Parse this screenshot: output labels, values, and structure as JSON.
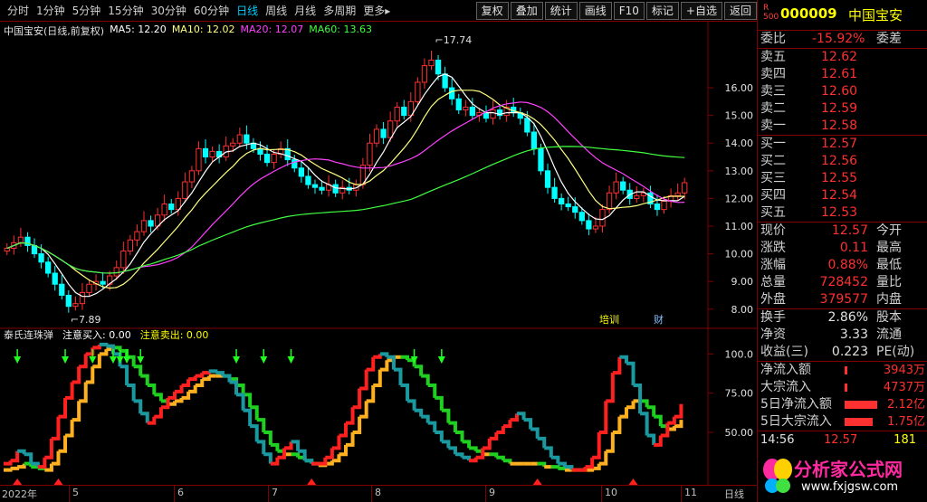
{
  "toolbar": {
    "periods": [
      {
        "label": "分时",
        "active": false
      },
      {
        "label": "1分钟",
        "active": false
      },
      {
        "label": "5分钟",
        "active": false
      },
      {
        "label": "15分钟",
        "active": false
      },
      {
        "label": "30分钟",
        "active": false
      },
      {
        "label": "60分钟",
        "active": false
      },
      {
        "label": "日线",
        "active": true
      },
      {
        "label": "周线",
        "active": false
      },
      {
        "label": "月线",
        "active": false
      },
      {
        "label": "多周期",
        "active": false
      },
      {
        "label": "更多▸",
        "active": false
      }
    ],
    "tools": [
      "复权",
      "叠加",
      "统计",
      "画线",
      "F10",
      "标记",
      "+自选",
      "返回"
    ]
  },
  "main_title": {
    "stock": "中国宝安(日线,前复权)",
    "ma": [
      {
        "label": "MA5: 12.20",
        "color": "#ffffff"
      },
      {
        "label": "MA10: 12.02",
        "color": "#ffff80"
      },
      {
        "label": "MA20: 12.07",
        "color": "#ff40ff"
      },
      {
        "label": "MA60: 13.63",
        "color": "#40ff40"
      }
    ]
  },
  "sub_title": {
    "name": "泰氏连珠弹",
    "buy": "注意买入: 0.00",
    "sell": "注意卖出: 0.00"
  },
  "chart_data": [
    {
      "type": "candlestick",
      "title": "中国宝安(日线,前复权)",
      "ylim": [
        7.6,
        17.8
      ],
      "y_ticks": [
        "16.00",
        "15.00",
        "14.00",
        "13.00",
        "12.00",
        "11.00",
        "10.00",
        "9.00",
        "8.00"
      ],
      "annotations": [
        "17.74",
        "7.89"
      ],
      "markers": [
        "培训",
        "财"
      ],
      "closes": [
        10.2,
        10.4,
        10.6,
        10.3,
        10.0,
        9.7,
        9.3,
        8.9,
        8.5,
        8.1,
        8.2,
        8.6,
        8.9,
        9.0,
        8.9,
        9.2,
        9.5,
        10.1,
        10.5,
        10.8,
        11.2,
        11.0,
        11.4,
        11.8,
        11.6,
        12.0,
        12.6,
        13.0,
        13.8,
        13.5,
        13.7,
        13.5,
        13.9,
        14.0,
        14.3,
        14.0,
        13.8,
        13.6,
        13.3,
        13.6,
        13.8,
        13.4,
        13.1,
        12.8,
        12.5,
        12.4,
        12.3,
        12.5,
        12.2,
        12.4,
        12.3,
        12.5,
        13.2,
        14.0,
        14.5,
        14.2,
        14.8,
        15.3,
        15.0,
        15.5,
        16.2,
        16.8,
        17.0,
        16.5,
        16.0,
        15.6,
        15.2,
        15.3,
        15.0,
        15.1,
        14.9,
        15.2,
        15.0,
        15.3,
        15.1,
        14.9,
        14.4,
        13.8,
        13.0,
        12.4,
        12.0,
        11.8,
        11.7,
        11.5,
        11.2,
        10.9,
        11.0,
        11.6,
        12.2,
        12.6,
        12.3,
        12.0,
        12.1,
        12.2,
        11.8,
        11.6,
        11.9,
        12.1,
        12.2,
        12.57
      ],
      "ma_series": [
        {
          "name": "MA5",
          "color": "#ffffff"
        },
        {
          "name": "MA10",
          "color": "#ffff80"
        },
        {
          "name": "MA20",
          "color": "#ff40ff"
        },
        {
          "name": "MA60",
          "color": "#40ff40"
        }
      ]
    },
    {
      "type": "line",
      "title": "泰氏连珠弹",
      "ylim": [
        20,
        110
      ],
      "y_ticks": [
        "100.0",
        "75.00",
        "50.00"
      ],
      "values_a": [
        30,
        32,
        38,
        36,
        30,
        28,
        34,
        46,
        60,
        72,
        82,
        92,
        100,
        104,
        106,
        105,
        100,
        92,
        80,
        70,
        62,
        56,
        60,
        66,
        72,
        76,
        80,
        84,
        86,
        88,
        89,
        88,
        86,
        82,
        74,
        64,
        54,
        44,
        36,
        30,
        34,
        40,
        44,
        38,
        32,
        30,
        30,
        34,
        40,
        48,
        56,
        66,
        78,
        90,
        98,
        100,
        98,
        90,
        80,
        70,
        64,
        60,
        56,
        50,
        44,
        40,
        36,
        34,
        32,
        34,
        40,
        46,
        50,
        54,
        58,
        62,
        58,
        52,
        46,
        40,
        34,
        30,
        28,
        26,
        26,
        28,
        34,
        50,
        70,
        88,
        98,
        94,
        80,
        62,
        48,
        42,
        48,
        56,
        60,
        68
      ],
      "values_b": [
        26,
        27,
        28,
        30,
        28,
        27,
        26,
        30,
        38,
        48,
        58,
        70,
        82,
        92,
        100,
        103,
        104,
        102,
        98,
        92,
        86,
        80,
        74,
        70,
        68,
        70,
        72,
        76,
        80,
        84,
        86,
        86,
        86,
        84,
        80,
        74,
        66,
        58,
        50,
        42,
        38,
        36,
        36,
        34,
        32,
        30,
        29,
        30,
        32,
        36,
        42,
        50,
        60,
        70,
        80,
        90,
        96,
        98,
        98,
        96,
        92,
        86,
        80,
        72,
        64,
        56,
        50,
        44,
        40,
        38,
        36,
        36,
        34,
        32,
        30,
        30,
        30,
        30,
        30,
        28,
        28,
        27,
        26,
        26,
        26,
        26,
        27,
        30,
        38,
        50,
        60,
        66,
        70,
        70,
        66,
        60,
        54,
        52,
        54,
        58
      ],
      "buy_markers": [
        2,
        9,
        13,
        16,
        17,
        18,
        20,
        34,
        38,
        42,
        60,
        64
      ]
    }
  ],
  "date_axis": [
    "2022年",
    "5",
    "6",
    "7",
    "8",
    "9",
    "10",
    "11",
    "日线"
  ],
  "panel": {
    "code": "000009",
    "name": "中国宝安",
    "flag_top": "R",
    "flag_bottom": "500",
    "weibi": {
      "label": "委比",
      "value": "-15.92%",
      "extra": "委差"
    },
    "sell": [
      {
        "label": "卖五",
        "price": "12.62"
      },
      {
        "label": "卖四",
        "price": "12.61"
      },
      {
        "label": "卖三",
        "price": "12.60"
      },
      {
        "label": "卖二",
        "price": "12.59"
      },
      {
        "label": "卖一",
        "price": "12.58"
      }
    ],
    "buy": [
      {
        "label": "买一",
        "price": "12.57"
      },
      {
        "label": "买二",
        "price": "12.56"
      },
      {
        "label": "买三",
        "price": "12.55"
      },
      {
        "label": "买四",
        "price": "12.54"
      },
      {
        "label": "买五",
        "price": "12.53"
      }
    ],
    "quote": [
      {
        "label": "现价",
        "value": "12.57",
        "extra": "今开"
      },
      {
        "label": "涨跌",
        "value": "0.11",
        "extra": "最高"
      },
      {
        "label": "涨幅",
        "value": "0.88%",
        "extra": "最低"
      },
      {
        "label": "总量",
        "value": "728452",
        "extra": "量比"
      },
      {
        "label": "外盘",
        "value": "379577",
        "extra": "内盘"
      }
    ],
    "stats": [
      {
        "label": "换手",
        "value": "2.86%",
        "extra": "股本"
      },
      {
        "label": "净资",
        "value": "3.33",
        "extra": "流通"
      },
      {
        "label": "收益(三)",
        "value": "0.223",
        "extra": "PE(动)"
      }
    ],
    "flows": [
      {
        "label": "净流入额",
        "value": "3943万",
        "bar": 0.05
      },
      {
        "label": "大宗流入",
        "value": "4737万",
        "bar": 0.05
      },
      {
        "label": "5日净流入额",
        "value": "2.12亿",
        "bar": 1.0
      },
      {
        "label": "5日大宗流入",
        "value": "1.75亿",
        "bar": 0.85
      }
    ],
    "tick": {
      "time": "14:56",
      "price": "12.57",
      "vol": "181"
    }
  },
  "logo": {
    "text": "分析家公式网",
    "url": "www.fxjgsw.com"
  }
}
